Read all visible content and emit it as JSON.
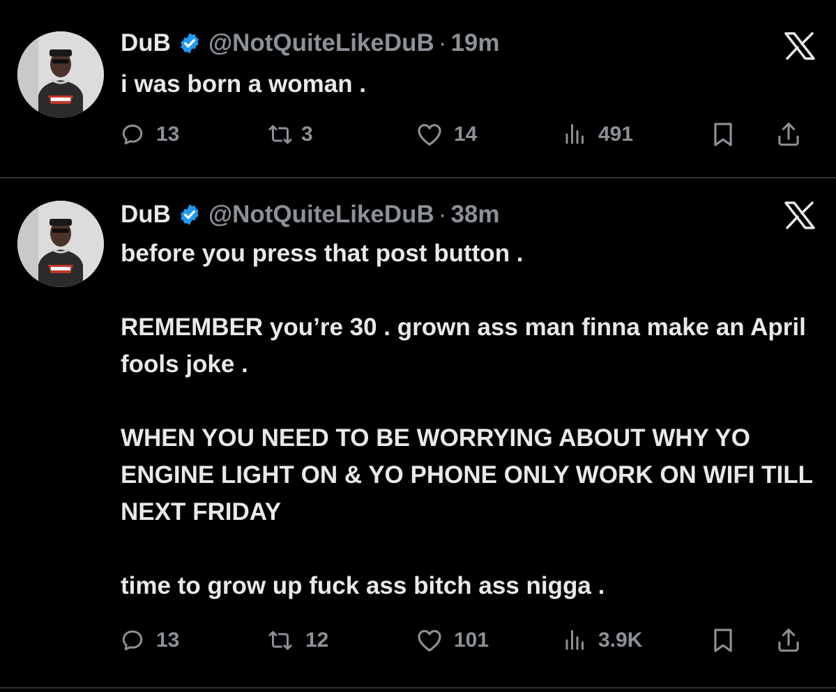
{
  "colors": {
    "background": "#000000",
    "text": "#e7e9ea",
    "muted": "#8b9197",
    "verified": "#1d9bf0",
    "divider": "#2f3336"
  },
  "tweets": [
    {
      "author": {
        "name": "DuB",
        "handle": "@NotQuiteLikeDuB",
        "verified_icon": "verified-badge-icon",
        "avatar_icon": "avatar-photo"
      },
      "separator": "·",
      "time": "19m",
      "paragraphs": [
        "i was born a woman ."
      ],
      "actions": {
        "replies": "13",
        "reposts": "3",
        "likes": "14",
        "views": "491"
      }
    },
    {
      "author": {
        "name": "DuB",
        "handle": "@NotQuiteLikeDuB",
        "verified_icon": "verified-badge-icon",
        "avatar_icon": "avatar-photo"
      },
      "separator": "·",
      "time": "38m",
      "paragraphs": [
        "before you press that post button .",
        "REMEMBER you’re 30 . grown ass man finna make an April fools joke .",
        "WHEN YOU NEED TO BE WORRYING ABOUT WHY YO ENGINE LIGHT ON & YO PHONE ONLY WORK ON WIFI TILL NEXT FRIDAY",
        "time to grow up fuck ass bitch ass nigga ."
      ],
      "actions": {
        "replies": "13",
        "reposts": "12",
        "likes": "101",
        "views": "3.9K"
      }
    }
  ]
}
